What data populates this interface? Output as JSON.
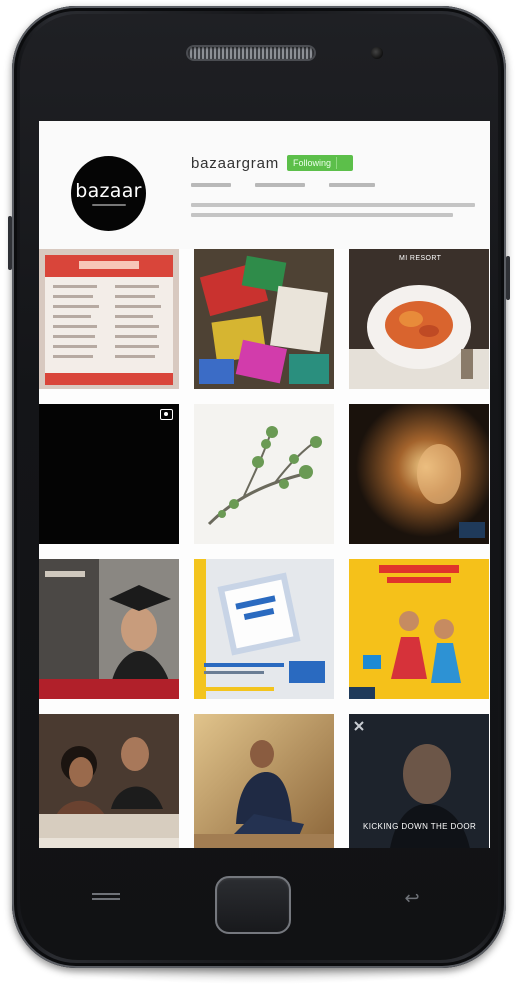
{
  "profile": {
    "avatar_logo_text": "bazaar",
    "username": "bazaargram",
    "follow_label": "Following"
  },
  "colors": {
    "follow_button": "#5cbf4a",
    "phone_body": "#17181b",
    "screen_background": "#fafafa"
  },
  "grid": {
    "posts": [
      {
        "id": "menu-card",
        "label": ""
      },
      {
        "id": "colorful-gifts",
        "label": ""
      },
      {
        "id": "pasta-plate",
        "label": "MI RESORT"
      },
      {
        "id": "video-black",
        "label": ""
      },
      {
        "id": "plant-branch",
        "label": ""
      },
      {
        "id": "candle-light",
        "label": ""
      },
      {
        "id": "graduate",
        "label": ""
      },
      {
        "id": "book-blue",
        "label": ""
      },
      {
        "id": "yellow-sale",
        "label": ""
      },
      {
        "id": "couple-table",
        "label": ""
      },
      {
        "id": "man-stairs",
        "label": ""
      },
      {
        "id": "dark-portrait",
        "label": "KICKING DOWN THE DOOR"
      }
    ]
  },
  "hardware": {
    "home_icon": "home-button-icon",
    "menu_icon": "menu-key-icon",
    "back_icon": "back-key-icon"
  }
}
